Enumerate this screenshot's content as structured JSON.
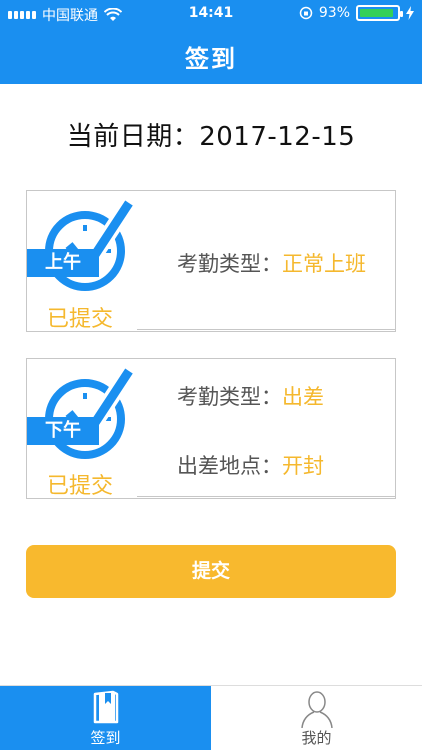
{
  "status_bar": {
    "carrier": "中国联通",
    "time": "14:41",
    "battery_percent": 93,
    "battery_text": "93%",
    "icons": [
      "signal-icon",
      "wifi-icon",
      "orientation-lock-icon",
      "battery-icon",
      "charging-icon"
    ]
  },
  "nav": {
    "title": "签到"
  },
  "date_line": {
    "text": "当前日期：2017-12-15"
  },
  "morning": {
    "badge": "上午",
    "status": "已提交",
    "rows": [
      {
        "key": "考勤类型：",
        "value": "正常上班"
      }
    ]
  },
  "afternoon": {
    "badge": "下午",
    "status": "已提交",
    "rows": [
      {
        "key": "考勤类型：",
        "value": "出差"
      },
      {
        "key": "出差地点：",
        "value": "开封"
      }
    ]
  },
  "submit": {
    "label": "提交"
  },
  "tabs": [
    {
      "label": "签到",
      "icon": "checkin-book-icon",
      "active": true
    },
    {
      "label": "我的",
      "icon": "user-profile-icon",
      "active": false
    }
  ],
  "colors": {
    "primary_blue": "#1a8ff0",
    "accent_yellow": "#f8b92e",
    "value_text": "#f5b82e"
  }
}
